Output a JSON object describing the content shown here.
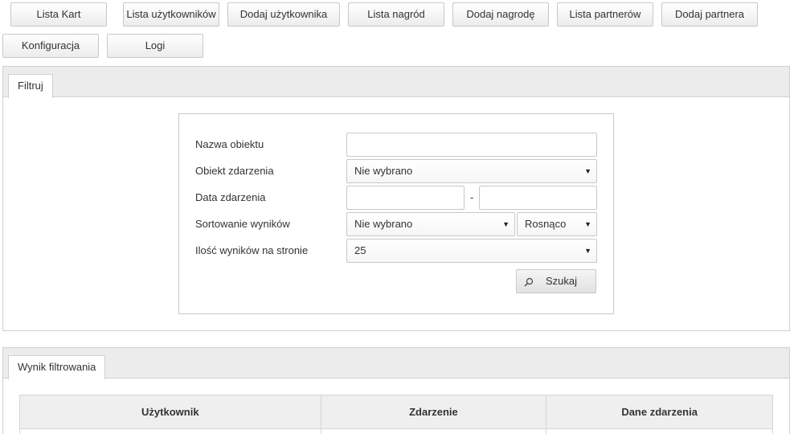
{
  "nav": {
    "row1": [
      "Lista Kart",
      "Lista użytkowników",
      "Dodaj użytkownika",
      "Lista nagród",
      "Dodaj nagrodę",
      "Lista partnerów",
      "Dodaj partnera"
    ],
    "row2": [
      "Konfiguracja",
      "Logi"
    ]
  },
  "filter_panel": {
    "tab_label": "Filtruj",
    "fields": {
      "object_name_label": "Nazwa obiektu",
      "object_name_value": "",
      "event_object_label": "Obiekt zdarzenia",
      "event_object_value": "Nie wybrano",
      "event_date_label": "Data zdarzenia",
      "date_from_value": "",
      "date_separator": "-",
      "date_to_value": "",
      "sort_label": "Sortowanie wyników",
      "sort_field_value": "Nie wybrano",
      "sort_order_value": "Rosnąco",
      "per_page_label": "Ilość wyników na stronie",
      "per_page_value": "25"
    },
    "search_label": "Szukaj"
  },
  "results_panel": {
    "tab_label": "Wynik filtrowania",
    "columns": [
      "Użytkownik",
      "Zdarzenie",
      "Dane zdarzenia"
    ]
  },
  "icons": {
    "search": "search-icon",
    "dropdown": "chevron-down-icon"
  },
  "colors": {
    "panel_header_bg": "#ececec",
    "border": "#d0d0d0",
    "table_header_bg": "#efefef"
  }
}
